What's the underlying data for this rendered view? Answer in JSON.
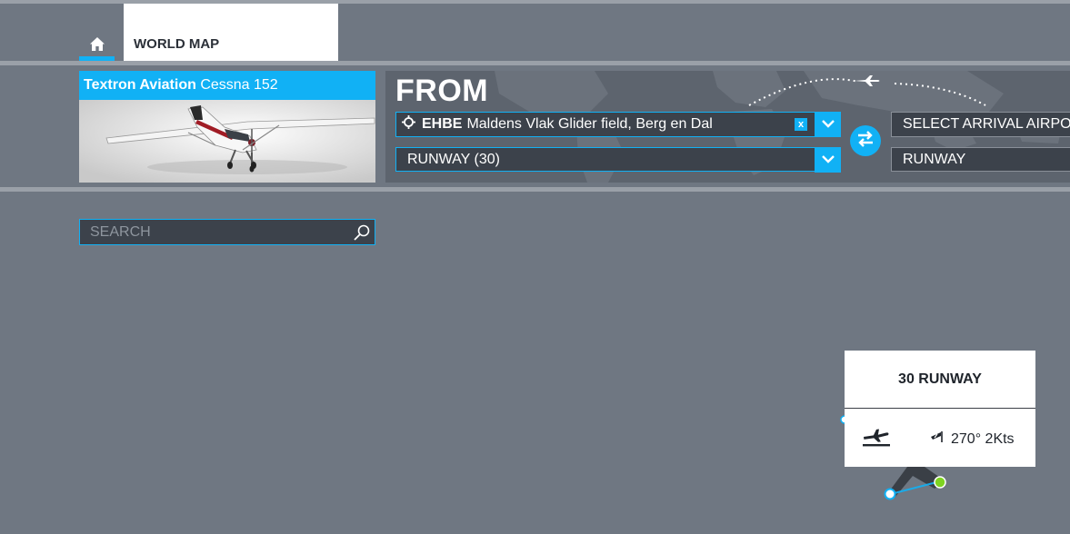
{
  "nav": {
    "home_icon": "home-icon",
    "world_map_tab": "WORLD MAP"
  },
  "aircraft": {
    "manufacturer": "Textron Aviation",
    "model": "Cessna 152"
  },
  "route": {
    "from_label": "FROM",
    "departure": {
      "icao": "EHBE",
      "name": "Maldens Vlak Glider field, Berg en Dal",
      "clear_label": "x"
    },
    "departure_runway": "RUNWAY (30)",
    "arrival_placeholder": "SELECT ARRIVAL AIRPORT",
    "arrival_runway": "RUNWAY"
  },
  "search": {
    "placeholder": "SEARCH"
  },
  "runway_popup": {
    "title": "30 RUNWAY",
    "wind": "270° 2Kts"
  },
  "colors": {
    "accent": "#11b1f5",
    "background": "#6f7782",
    "panel": "#3c424b",
    "runway_start": "#7ed321"
  }
}
